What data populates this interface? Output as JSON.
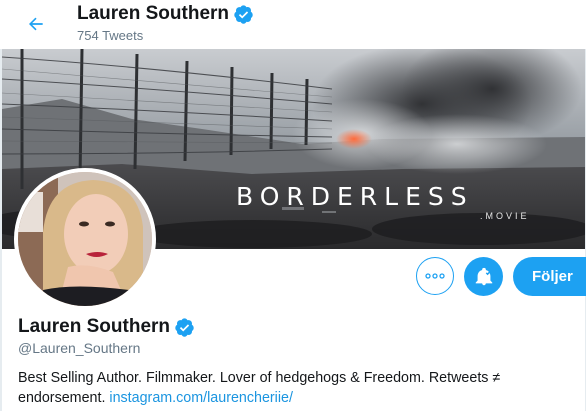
{
  "header": {
    "name": "Lauren Southern",
    "tweet_count": "754 Tweets"
  },
  "banner": {
    "title": "BORDERLESS",
    "subtitle": ".MOVIE"
  },
  "actions": {
    "more_icon": "more-horizontal-icon",
    "bell_icon": "bell-check-icon",
    "follow_label": "Följer"
  },
  "profile": {
    "name": "Lauren Southern",
    "handle": "@Lauren_Southern",
    "bio_text": "Best Selling Author. Filmmaker. Lover of hedgehogs & Freedom. Retweets ≠ endorsement.",
    "bio_link": "instagram.com/laurencheriie/"
  },
  "colors": {
    "accent": "#1da1f2",
    "text_secondary": "#657786",
    "link": "#1b95e0"
  }
}
